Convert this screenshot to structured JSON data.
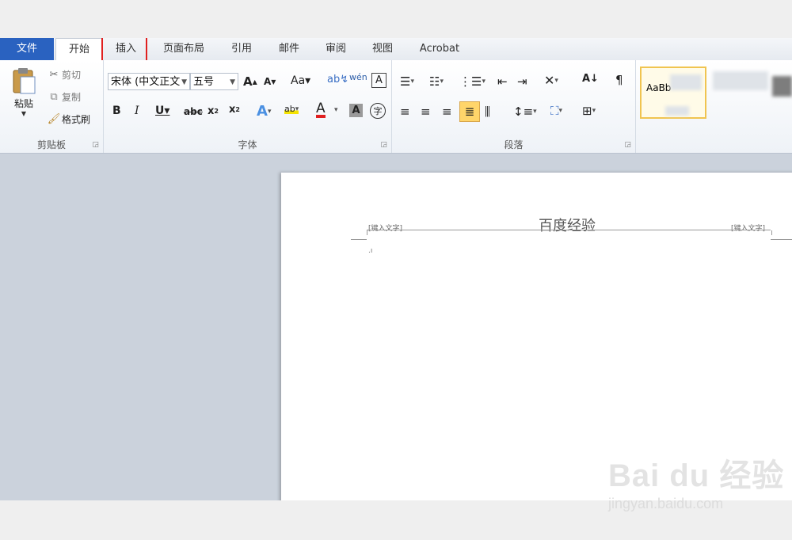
{
  "tabs": [
    "文件",
    "开始",
    "插入",
    "页面布局",
    "引用",
    "邮件",
    "审阅",
    "视图",
    "Acrobat"
  ],
  "clipboard": {
    "paste": "粘贴",
    "cut": "剪切",
    "copy": "复制",
    "format_painter": "格式刷",
    "label": "剪贴板"
  },
  "font": {
    "name": "宋体 (中文正文",
    "size": "五号",
    "label": "字体"
  },
  "paragraph": {
    "label": "段落"
  },
  "styles": {
    "preview": "AaBb"
  },
  "document": {
    "header_left": "[键入文字]",
    "header_center": "百度经验",
    "header_right": "[键入文字]",
    "cursor_mark": ".ı"
  },
  "watermark": {
    "main": "Bai du 经验",
    "sub": "jingyan.baidu.com"
  },
  "colors": {
    "file_tab": "#2a62c0",
    "highlight_box": "#e02020",
    "selected_style": "#f0c450"
  }
}
